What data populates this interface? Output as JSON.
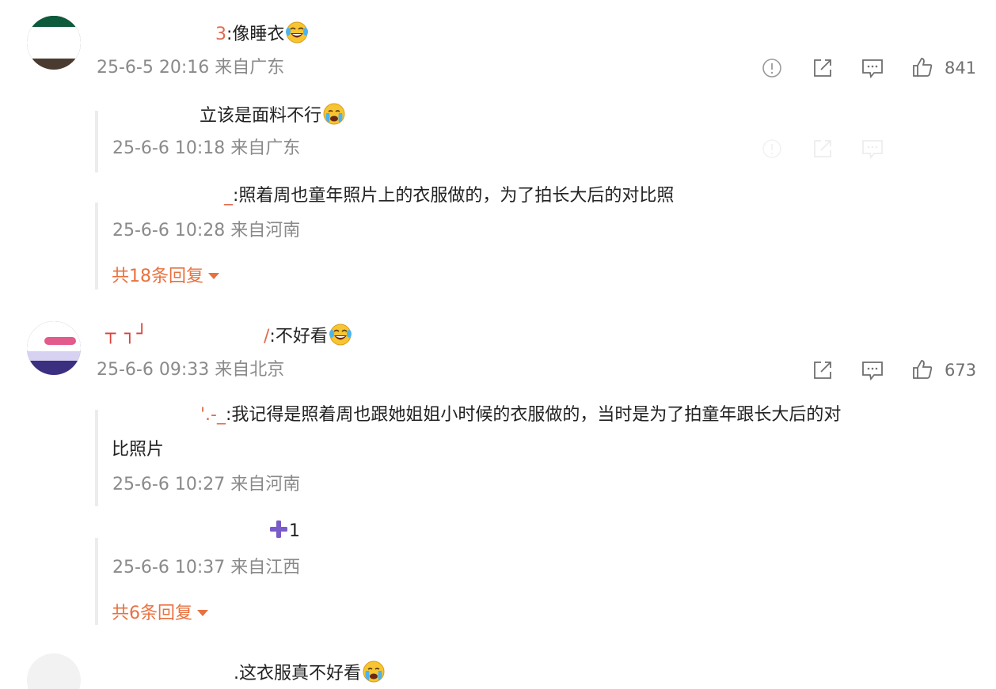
{
  "comments": [
    {
      "name_remnant": "3",
      "text": ":像睡衣",
      "time": "25-6-5 20:16",
      "location": "来自广东",
      "likes": "841",
      "replies": [
        {
          "name_remnant": "",
          "text": "立该是面料不行",
          "time": "25-6-6 10:18",
          "location": "来自广东"
        },
        {
          "name_remnant": "_",
          "text": ":照着周也童年照片上的衣服做的，为了拍长大后的对比照",
          "time": "25-6-6 10:28",
          "location": "来自河南"
        }
      ],
      "more_replies": "共18条回复"
    },
    {
      "name_remnant": "/",
      "text": ":不好看",
      "time": "25-6-6 09:33",
      "location": "来自北京",
      "likes": "673",
      "replies": [
        {
          "name_remnant": "'.-_",
          "text": ":我记得是照着周也跟她姐姐小时候的衣服做的，当时是为了拍童年跟长大后的对",
          "text_line2": "比照片",
          "time": "25-6-6 10:27",
          "location": "来自河南"
        },
        {
          "name_remnant": "",
          "text": "1",
          "time": "25-6-6 10:37",
          "location": "来自江西"
        }
      ],
      "more_replies": "共6条回复"
    },
    {
      "name_remnant": "",
      "text": ".这衣服真不好看"
    }
  ],
  "icons": {
    "report": "report-icon",
    "share": "share-icon",
    "comment": "comment-icon",
    "like": "thumbs-up-icon",
    "laugh_emoji": "laughing-tears-emoji",
    "cry_emoji": "crying-emoji",
    "plus_emoji": "purple-plus-emoji"
  },
  "colors": {
    "link_orange": "#e8713f",
    "meta_gray": "#8a8a8a",
    "text_dark": "#222222"
  }
}
